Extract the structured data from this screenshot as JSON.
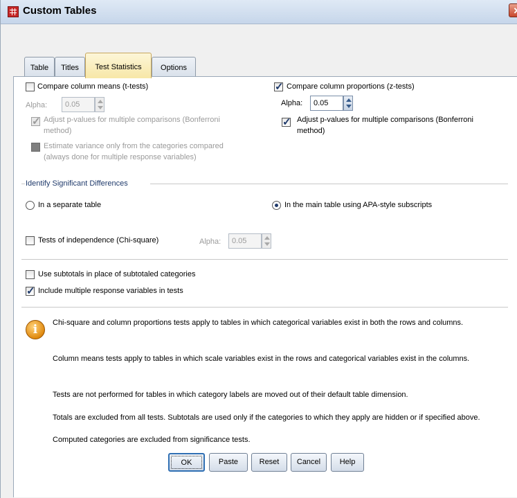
{
  "window": {
    "title": "Custom Tables"
  },
  "tabs": [
    {
      "label": "Table"
    },
    {
      "label": "Titles"
    },
    {
      "label": "Test Statistics"
    },
    {
      "label": "Options"
    }
  ],
  "compare_means": {
    "label": "Compare column means (t-tests)",
    "checked": false,
    "alpha_label": "Alpha:",
    "alpha_value": "0.05",
    "adjust_label_line1": "Adjust p-values for multiple comparisons (Bonferroni",
    "adjust_label_line2": "method)",
    "estimate_label_line1": "Estimate variance only from the categories compared",
    "estimate_label_line2": "(always done for multiple response variables)"
  },
  "compare_props": {
    "label": "Compare column proportions (z-tests)",
    "checked": true,
    "alpha_label": "Alpha:",
    "alpha_value": "0.05",
    "adjust_label_line1": "Adjust p-values for multiple comparisons (Bonferroni",
    "adjust_label_line2": "method)"
  },
  "identify": {
    "legend": "Identify Significant Differences",
    "option_separate": "In a separate table",
    "option_main": "In the main table using APA-style subscripts",
    "selected": "In the main table using APA-style subscripts"
  },
  "chisquare": {
    "label": "Tests of independence (Chi-square)",
    "alpha_label": "Alpha:",
    "alpha_value": "0.05"
  },
  "subtotals_label": "Use subtotals in place of subtotaled categories",
  "multiple_response_label": "Include multiple response variables in tests",
  "info": [
    "Chi-square and column proportions tests apply to tables in which categorical variables exist in both the rows and columns.",
    "Column means tests apply to tables in which scale variables exist in the rows and categorical variables exist in the columns.",
    "Tests are not performed for tables in which category labels are moved out of their default table dimension.",
    "Totals are excluded from all tests. Subtotals are used only if the categories to which they apply are hidden or if specified above.",
    "Computed categories are excluded from significance tests."
  ],
  "buttons": {
    "ok": "OK",
    "paste": "Paste",
    "reset": "Reset",
    "cancel": "Cancel",
    "help": "Help"
  }
}
